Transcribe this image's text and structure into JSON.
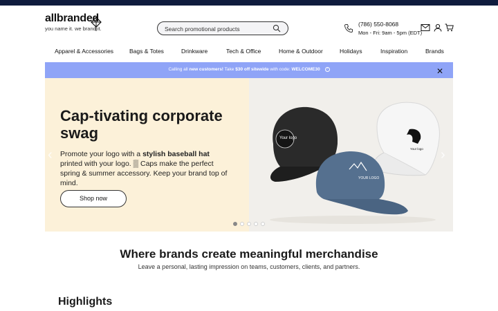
{
  "brand": {
    "name": "allbranded",
    "tagline": "you name it. we brand it."
  },
  "search": {
    "placeholder": "Search promotional products"
  },
  "contact": {
    "phone": "(786) 550-8068",
    "hours": "Mon - Fri: 9am - 5pm (EDT)"
  },
  "nav": {
    "items": [
      "Apparel & Accessories",
      "Bags & Totes",
      "Drinkware",
      "Tech & Office",
      "Home & Outdoor",
      "Holidays",
      "Inspiration",
      "Brands"
    ]
  },
  "promo": {
    "part1": "Calling all ",
    "part2": "new customers!",
    "part3": " Take ",
    "part4": "$30 off sitewide",
    "part5": " with code: ",
    "part6": "WELCOME30",
    "question_icon": "?",
    "close_label": "✕"
  },
  "hero": {
    "title": "Cap-tivating corporate swag",
    "body_pre": "Promote your logo with a ",
    "body_bold": "stylish baseball hat",
    "body_post": " printed with your logo. ▒ Caps make the perfect spring & summer accessory. Keep your brand top of mind.",
    "cta": "Shop now",
    "slide_count": 5,
    "active_slide": 1,
    "cap_labels": [
      "Your logo",
      "YOUR LOGO",
      "Your logo"
    ]
  },
  "section": {
    "tagline": "Where brands create meaningful merchandise",
    "subline": "Leave a personal, lasting impression on teams, customers, clients, and partners.",
    "highlights": "Highlights"
  },
  "colors": {
    "topbar": "#0f1b3d",
    "promo_bg": "#8fa4f7",
    "hero_bg": "#fcf1d9"
  }
}
